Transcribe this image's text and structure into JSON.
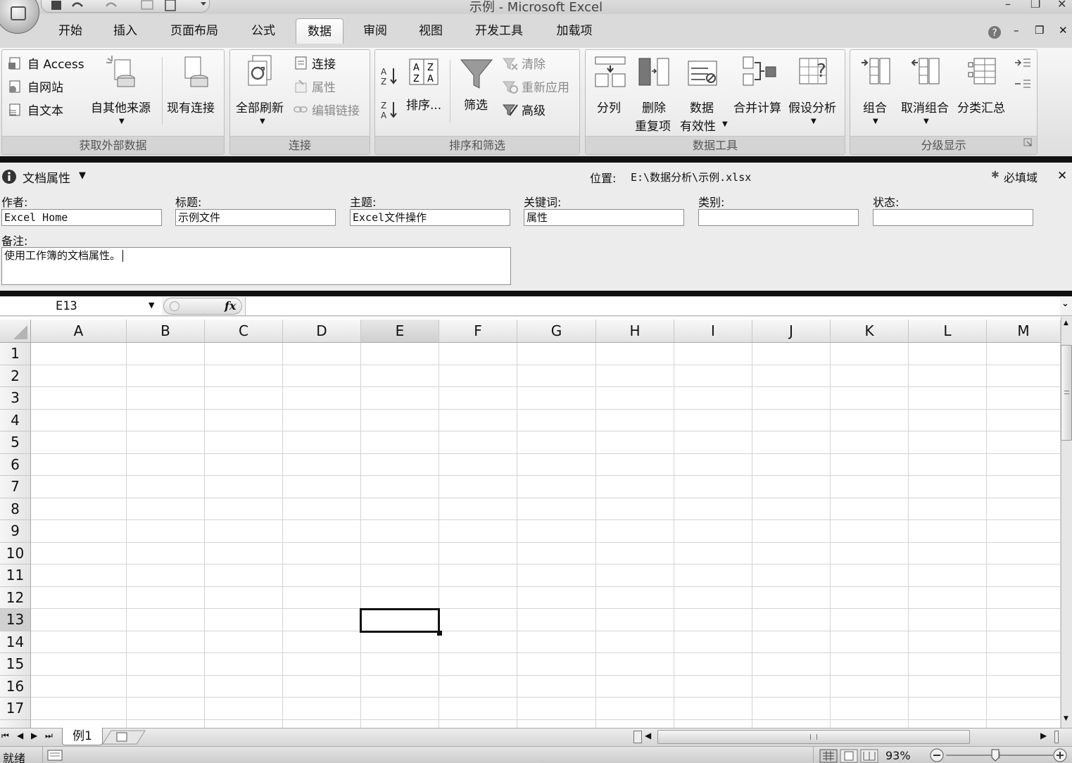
{
  "window": {
    "title": "示例 - Microsoft Excel"
  },
  "ribbon_tabs": [
    {
      "label": "开始",
      "active": false
    },
    {
      "label": "插入",
      "active": false
    },
    {
      "label": "页面布局",
      "active": false
    },
    {
      "label": "公式",
      "active": false
    },
    {
      "label": "数据",
      "active": true
    },
    {
      "label": "审阅",
      "active": false
    },
    {
      "label": "视图",
      "active": false
    },
    {
      "label": "开发工具",
      "active": false
    },
    {
      "label": "加载项",
      "active": false
    }
  ],
  "ribbon": {
    "get_external": {
      "group_label": "获取外部数据",
      "from_access": "自 Access",
      "from_web": "自网站",
      "from_text": "自文本",
      "from_other": "自其他来源",
      "existing": "现有连接"
    },
    "connections": {
      "group_label": "连接",
      "refresh_all": "全部刷新",
      "connections": "连接",
      "properties": "属性",
      "edit_links": "编辑链接"
    },
    "sort_filter": {
      "group_label": "排序和筛选",
      "sort": "排序...",
      "filter": "筛选",
      "clear": "清除",
      "reapply": "重新应用",
      "advanced": "高级"
    },
    "data_tools": {
      "group_label": "数据工具",
      "text_to_columns": "分列",
      "remove_dup_1": "删除",
      "remove_dup_2": "重复项",
      "validation_1": "数据",
      "validation_2": "有效性",
      "consolidate": "合并计算",
      "what_if": "假设分析"
    },
    "outline": {
      "group_label": "分级显示",
      "group": "组合",
      "ungroup": "取消组合",
      "subtotal": "分类汇总"
    }
  },
  "doc_props": {
    "title": "文档属性",
    "location_label": "位置:",
    "location_value": "E:\\数据分析\\示例.xlsx",
    "required": "必填域",
    "author_label": "作者:",
    "author_value": "Excel Home",
    "title_label": "标题:",
    "title_value": "示例文件",
    "subject_label": "主题:",
    "subject_value": "Excel文件操作",
    "keywords_label": "关键词:",
    "keywords_value": "属性",
    "category_label": "类别:",
    "category_value": "",
    "status_label": "状态:",
    "status_value": "",
    "comments_label": "备注:",
    "comments_value": "使用工作簿的文档属性。"
  },
  "formula_bar": {
    "name_box": "E13",
    "fx": "fx",
    "formula": ""
  },
  "grid": {
    "columns": [
      "A",
      "B",
      "C",
      "D",
      "E",
      "F",
      "G",
      "H",
      "I",
      "J",
      "K",
      "L",
      "M"
    ],
    "rows": [
      "1",
      "2",
      "3",
      "4",
      "5",
      "6",
      "7",
      "8",
      "9",
      "10",
      "11",
      "12",
      "13",
      "14",
      "15",
      "16",
      "17"
    ],
    "active_cell": "E13"
  },
  "sheet_tabs": [
    "例1"
  ],
  "status": {
    "ready": "就绪",
    "zoom": "93%"
  }
}
